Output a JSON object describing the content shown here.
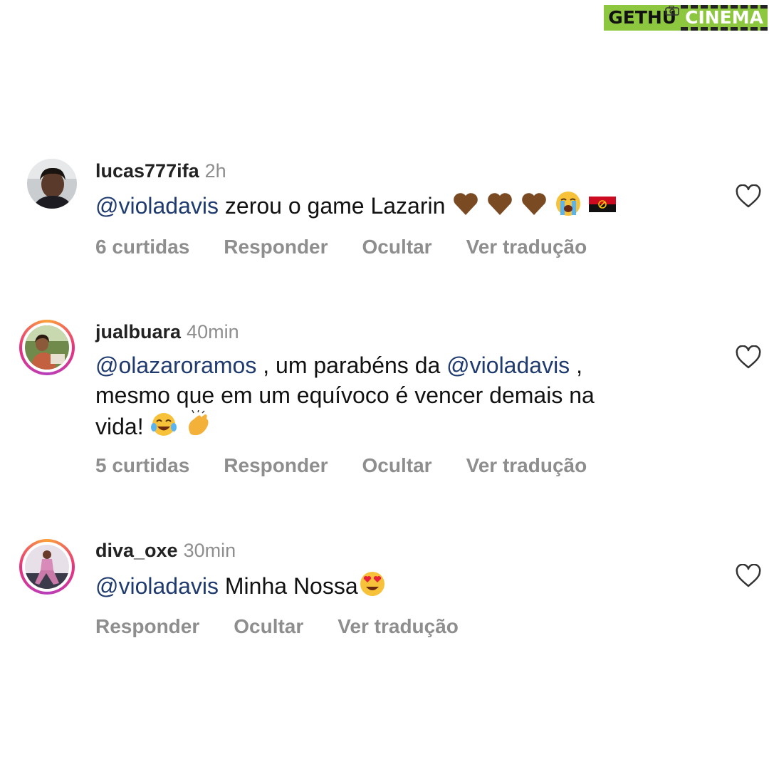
{
  "watermark": {
    "left": "GETHU",
    "right": "CINEMA"
  },
  "colors": {
    "mention": "#1f3a6e",
    "muted": "#8e8e8e",
    "story_ring_start": "#f9a23a",
    "story_ring_end": "#b63fbb",
    "watermark_green": "#8dc63f"
  },
  "comments": [
    {
      "username": "lucas777ifa",
      "time": "2h",
      "mention": "@violadavis",
      "text": " zerou o game Lazarin ",
      "emojis": [
        "brown-heart",
        "brown-heart",
        "brown-heart",
        "loudly-crying-face",
        "angola-flag"
      ],
      "likes": "6 curtidas",
      "reply": "Responder",
      "hide": "Ocultar",
      "translate": "Ver tradução",
      "story_ring": false
    },
    {
      "username": "jualbuara",
      "time": "40min",
      "mention1": "@olazaroramos",
      "text1": " , um parabéns da ",
      "mention2": "@violadavis",
      "text2": " ,",
      "line2": "mesmo que em um equívoco é vencer demais na",
      "line3": "vida! ",
      "emojis": [
        "tears-of-joy-face",
        "clapping-hands"
      ],
      "likes": "5 curtidas",
      "reply": "Responder",
      "hide": "Ocultar",
      "translate": "Ver tradução",
      "story_ring": true
    },
    {
      "username": "diva_oxe",
      "time": "30min",
      "mention": "@violadavis",
      "text": " Minha Nossa",
      "emojis": [
        "heart-eyes-face"
      ],
      "reply": "Responder",
      "hide": "Ocultar",
      "translate": "Ver tradução",
      "story_ring": true
    }
  ]
}
